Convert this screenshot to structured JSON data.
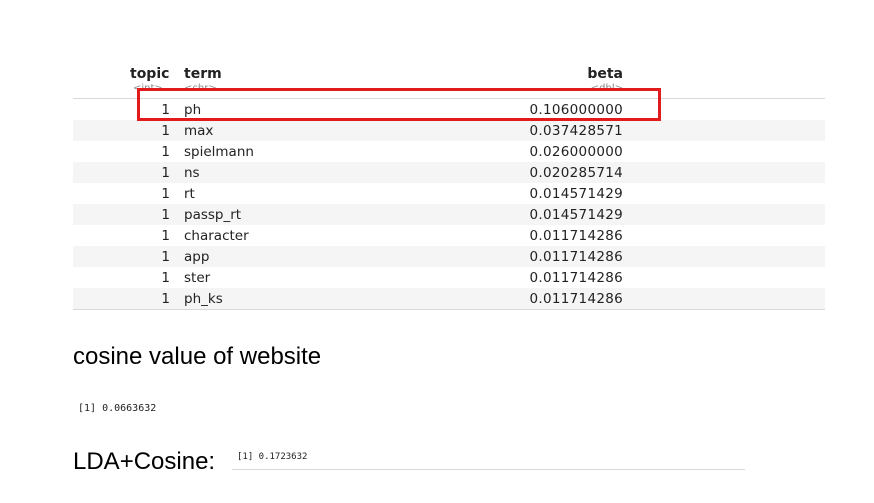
{
  "table": {
    "headers": {
      "topic": "topic",
      "topic_type": "<int>",
      "term": "term",
      "term_type": "<chr>",
      "beta": "beta",
      "beta_type": "<dbl>"
    },
    "rows": [
      {
        "topic": "1",
        "term": "ph",
        "beta": "0.106000000"
      },
      {
        "topic": "1",
        "term": "max",
        "beta": "0.037428571"
      },
      {
        "topic": "1",
        "term": "spielmann",
        "beta": "0.026000000"
      },
      {
        "topic": "1",
        "term": "ns",
        "beta": "0.020285714"
      },
      {
        "topic": "1",
        "term": "rt",
        "beta": "0.014571429"
      },
      {
        "topic": "1",
        "term": "passp_rt",
        "beta": "0.014571429"
      },
      {
        "topic": "1",
        "term": "character",
        "beta": "0.011714286"
      },
      {
        "topic": "1",
        "term": "app",
        "beta": "0.011714286"
      },
      {
        "topic": "1",
        "term": "ster",
        "beta": "0.011714286"
      },
      {
        "topic": "1",
        "term": "ph_ks",
        "beta": "0.011714286"
      }
    ]
  },
  "highlight_color": "#e11b1b",
  "cosine": {
    "heading": "cosine value of website",
    "output": "[1] 0.0663632"
  },
  "lda_cosine": {
    "label": "LDA+Cosine:",
    "output": "[1] 0.1723632"
  }
}
